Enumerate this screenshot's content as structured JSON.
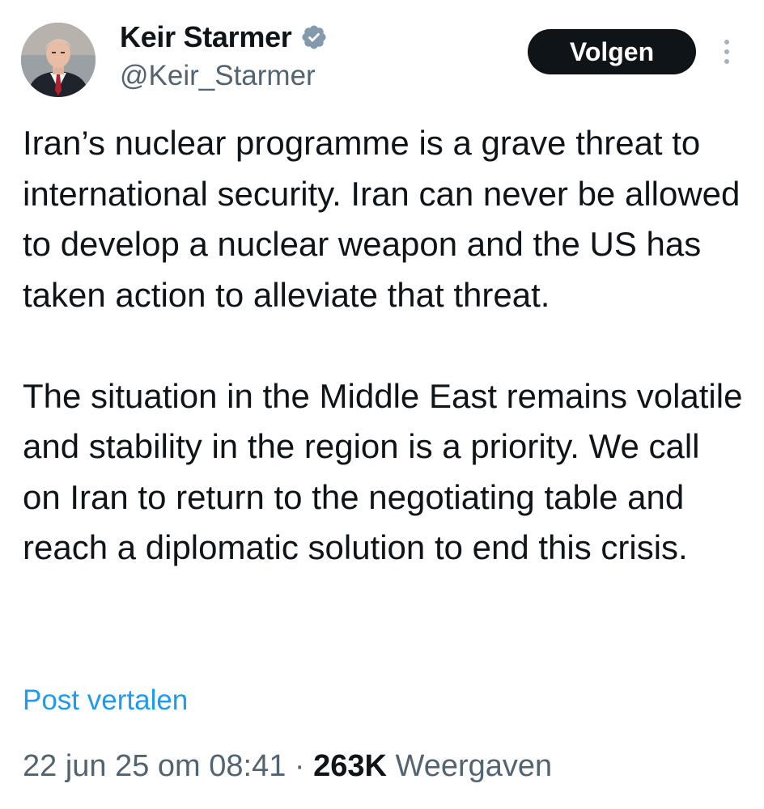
{
  "author": {
    "display_name": "Keir Starmer",
    "handle": "@Keir_Starmer",
    "verified": true,
    "avatar_icon": "profile-photo"
  },
  "actions": {
    "follow_label": "Volgen",
    "more_icon": "more-options-icon"
  },
  "tweet": {
    "paragraphs": [
      "Iran’s nuclear programme is a grave threat to international security. Iran can never be allowed to develop a nuclear weapon and the US has taken action to alleviate that threat.",
      "The situation in the Middle East remains volatile and stability in the region is a priority. We call on Iran to return to the negotiating table and reach a diplomatic solution to end this crisis."
    ],
    "translate_label": "Post vertalen"
  },
  "meta": {
    "timestamp": "22 jun 25 om 08:41",
    "separator": "·",
    "views_count": "263K",
    "views_label": "Weergaven"
  },
  "colors": {
    "text_primary": "#0f1419",
    "text_secondary": "#536471",
    "link": "#1d9bf0",
    "button_bg": "#0f1419",
    "verified_badge": "#829aab"
  }
}
